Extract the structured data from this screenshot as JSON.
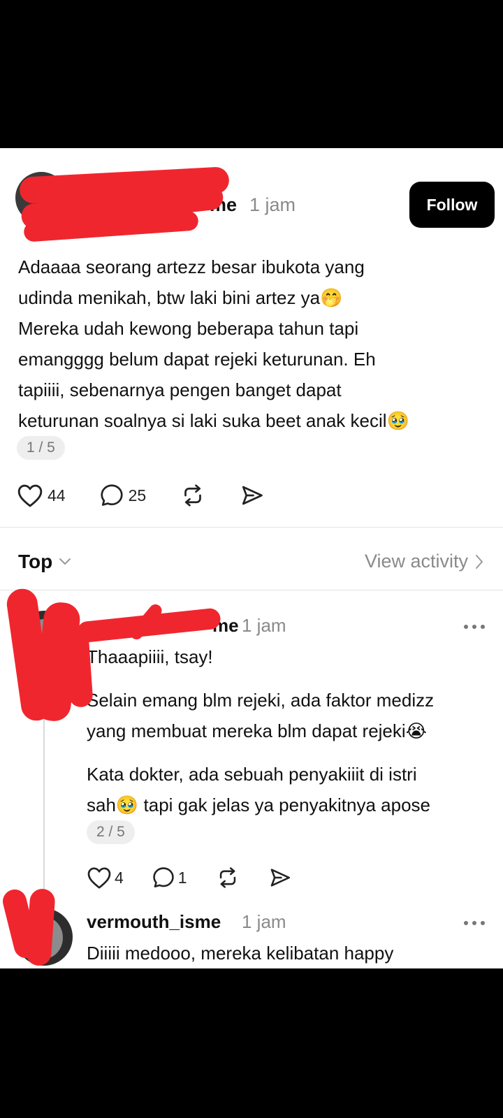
{
  "main_post": {
    "username_visible": "me",
    "time": "1 jam",
    "follow_label": "Follow",
    "lines": [
      "Adaaaa seorang artezz besar ibukota yang",
      "udinda menikah, btw laki bini artez ya🤭",
      "Mereka udah kewong beberapa tahun tapi",
      "emangggg belum dapat rejeki keturunan. Eh",
      "tapiiii, sebenarnya pengen banget dapat",
      "keturunan soalnya si laki suka beet anak kecil🥹"
    ],
    "page": "1 / 5",
    "likes": "44",
    "comments": "25"
  },
  "sort": {
    "label": "Top",
    "view_activity": "View activity"
  },
  "reply1": {
    "username_visible": "me",
    "time": "1 jam",
    "paragraphs": [
      [
        "Thaaapiiii, tsay!"
      ],
      [
        "Selain emang blm rejeki, ada faktor medizz",
        "yang membuat mereka blm dapat rejeki😭"
      ],
      [
        "Kata dokter, ada sebuah penyakiiit di istri",
        "sah🥹 tapi gak jelas ya penyakitnya apose"
      ]
    ],
    "page": "2 / 5",
    "likes": "4",
    "comments": "1"
  },
  "reply2": {
    "username": "vermouth_isme",
    "time": "1 jam",
    "first_line": "Diiiii medooo, mereka kelibatan happy"
  },
  "colors": {
    "censor": "#f0262f",
    "follow_bg": "#000000",
    "muted": "#8a8a8a"
  },
  "icons": [
    "heart-icon",
    "comment-icon",
    "repost-icon",
    "share-icon",
    "chevron-down-icon",
    "chevron-right-icon",
    "more-icon",
    "plus-icon"
  ]
}
